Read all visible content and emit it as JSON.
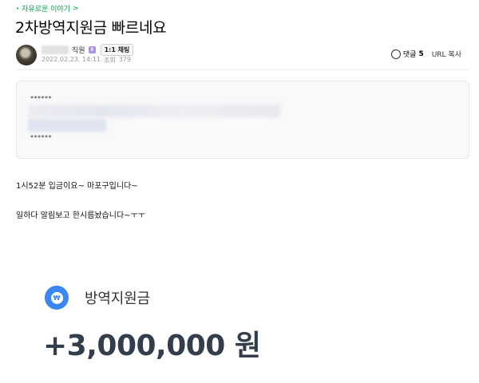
{
  "breadcrumb": {
    "bullet": "•",
    "board": "자유로운 이야기",
    "chevron": ">"
  },
  "post": {
    "title": "2차방역지원금 빠르네요",
    "author": {
      "rank": "직원",
      "rank_badge": "3",
      "chat_button": "1:1 채팅"
    },
    "meta": {
      "date": "2022.02.23. 14:11",
      "views_label": "조회",
      "views": "379"
    },
    "actions": {
      "comment_label": "댓글",
      "comment_count": "5",
      "url_copy": "URL 복사"
    },
    "quote": {
      "top_marker": "******",
      "bottom_marker": "******"
    },
    "body_lines": [
      "1시52분 입금이요~ 마포구입니다~",
      "일하다 알림보고 한시름놨습니다~ㅜㅜ"
    ],
    "notification": {
      "icon": "won-icon",
      "label": "방역지원금",
      "amount": "+3,000,000 원"
    }
  },
  "colors": {
    "breadcrumb": "#03a94d",
    "won_icon": "#3a86f5",
    "amount": "#333d4b"
  }
}
